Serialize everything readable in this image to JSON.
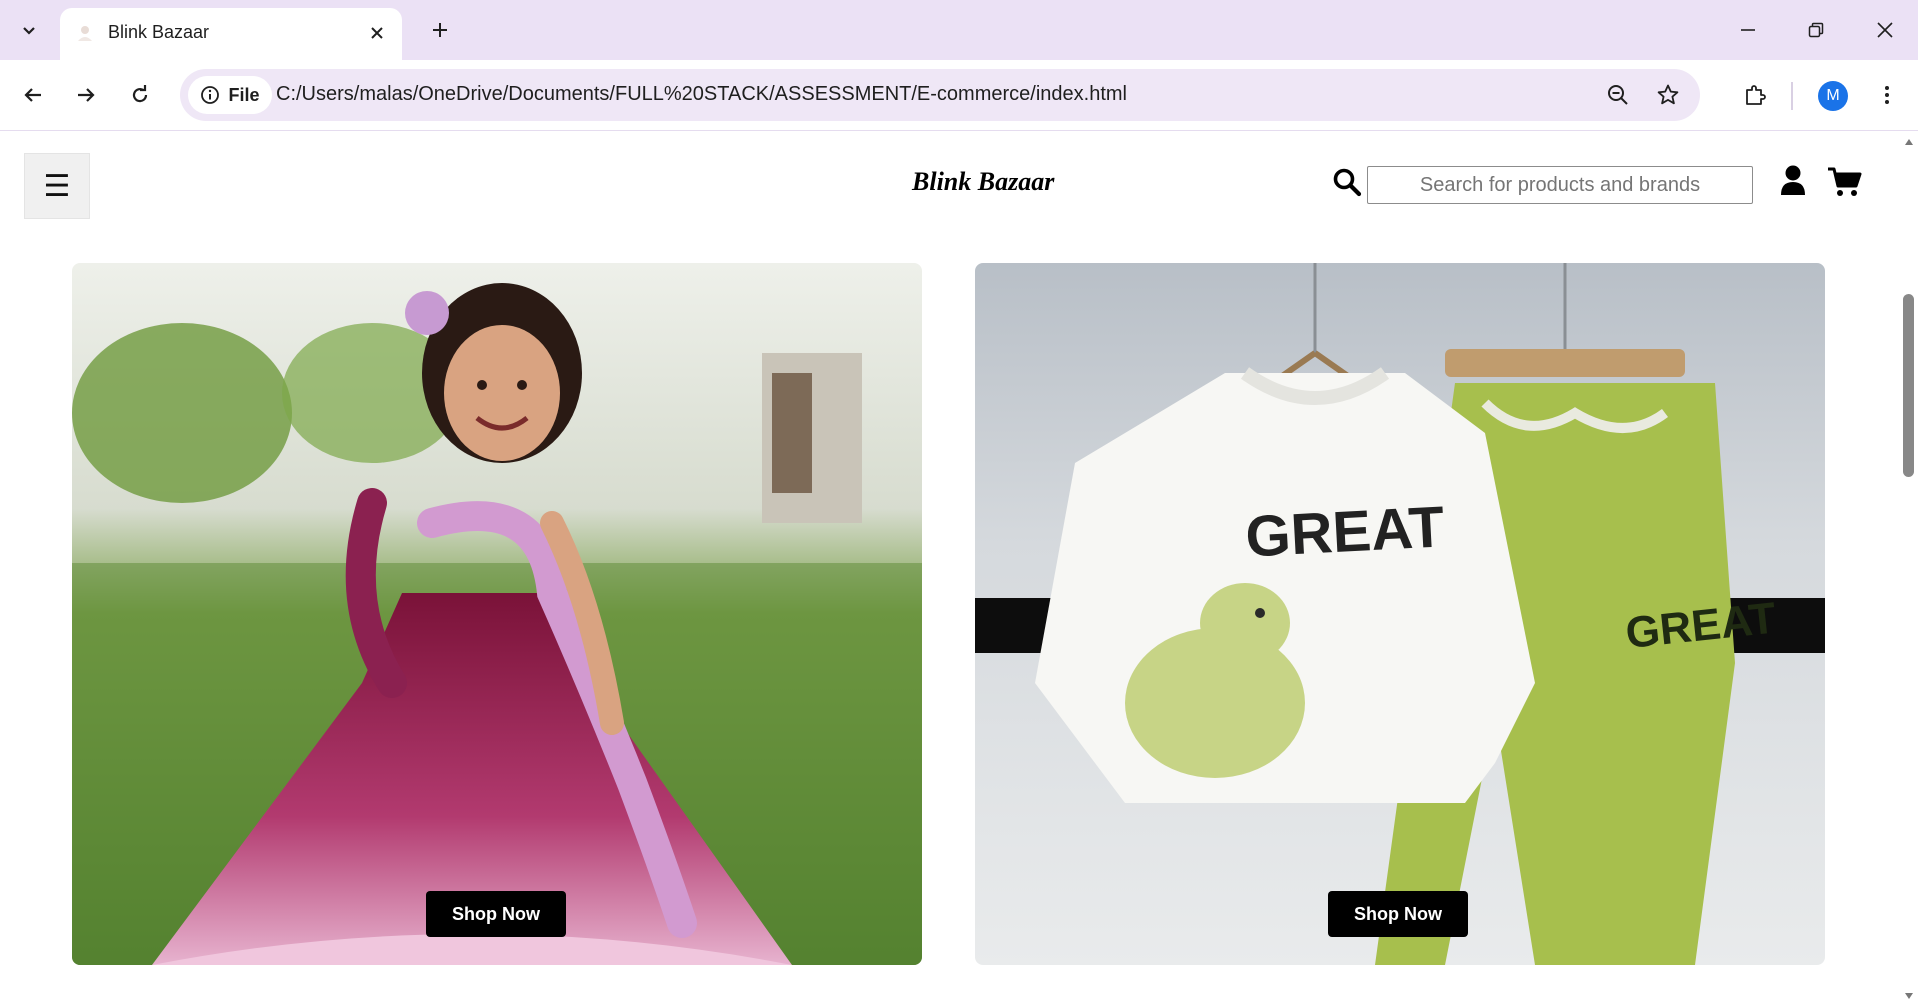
{
  "browser": {
    "tab_title": "Blink Bazaar",
    "url": "C:/Users/malas/OneDrive/Documents/FULL%20STACK/ASSESSMENT/E-commerce/index.html",
    "file_chip_label": "File",
    "profile_initial": "M",
    "accent_color": "#ebe1f5"
  },
  "site": {
    "brand": "Blink Bazaar",
    "menu_glyph": "☰",
    "search_placeholder": "Search for products and brands",
    "icons": [
      "menu-icon",
      "search-icon",
      "user-icon",
      "cart-icon"
    ]
  },
  "products": [
    {
      "name": "girls-party-gown",
      "image_icon": "girl-in-pink-gown-image",
      "cta": "Shop Now"
    },
    {
      "name": "kids-dino-sweatshirt-set",
      "image_icon": "great-dino-sweatshirt-and-joggers-image",
      "cta": "Shop Now"
    }
  ]
}
